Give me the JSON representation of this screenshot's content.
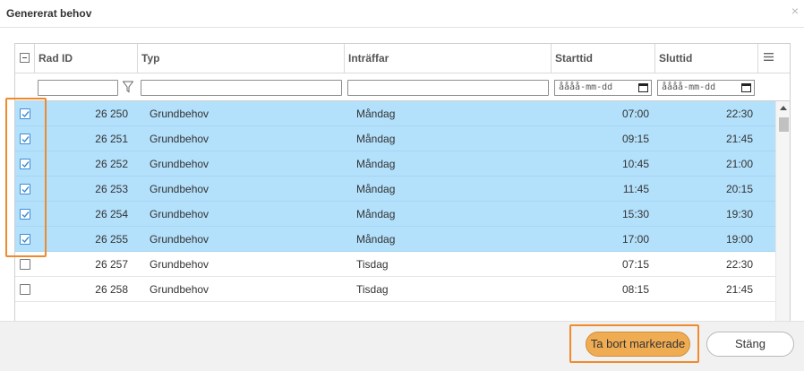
{
  "dialog": {
    "title": "Genererat behov",
    "close_glyph": "×"
  },
  "columns": {
    "rad_id": "Rad ID",
    "typ": "Typ",
    "intraffar": "Inträffar",
    "starttid": "Starttid",
    "sluttid": "Sluttid"
  },
  "filters": {
    "date_placeholder_start": "åååå-mm-dd",
    "date_placeholder_end": "åååå-mm-dd"
  },
  "rows": [
    {
      "id": "26 250",
      "typ": "Grundbehov",
      "dag": "Måndag",
      "start": "07:00",
      "slut": "22:30",
      "selected": true
    },
    {
      "id": "26 251",
      "typ": "Grundbehov",
      "dag": "Måndag",
      "start": "09:15",
      "slut": "21:45",
      "selected": true
    },
    {
      "id": "26 252",
      "typ": "Grundbehov",
      "dag": "Måndag",
      "start": "10:45",
      "slut": "21:00",
      "selected": true
    },
    {
      "id": "26 253",
      "typ": "Grundbehov",
      "dag": "Måndag",
      "start": "11:45",
      "slut": "20:15",
      "selected": true
    },
    {
      "id": "26 254",
      "typ": "Grundbehov",
      "dag": "Måndag",
      "start": "15:30",
      "slut": "19:30",
      "selected": true
    },
    {
      "id": "26 255",
      "typ": "Grundbehov",
      "dag": "Måndag",
      "start": "17:00",
      "slut": "19:00",
      "selected": true
    },
    {
      "id": "26 257",
      "typ": "Grundbehov",
      "dag": "Tisdag",
      "start": "07:15",
      "slut": "22:30",
      "selected": false
    },
    {
      "id": "26 258",
      "typ": "Grundbehov",
      "dag": "Tisdag",
      "start": "08:15",
      "slut": "21:45",
      "selected": false
    }
  ],
  "buttons": {
    "delete_selected": "Ta bort markerade",
    "close": "Stäng"
  },
  "colors": {
    "selected_row": "#b3e0fb",
    "accent_orange": "#f0ac52",
    "highlight_border": "#ef8b2c",
    "checkbox_blue": "#3b8bd6"
  },
  "icons": {
    "header_checkbox": "minus-checkbox-icon",
    "filter": "funnel-icon",
    "calendar": "calendar-icon",
    "column_menu": "hamburger-menu-icon",
    "close": "close-icon"
  }
}
